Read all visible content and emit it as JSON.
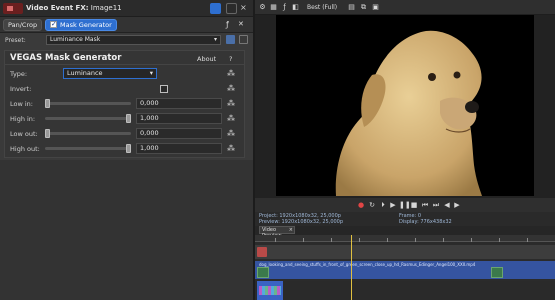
{
  "fx_window": {
    "title_prefix": "Video Event FX:",
    "title_event": "Image11"
  },
  "fx_chain": {
    "items": [
      {
        "label": "Pan/Crop",
        "active": false
      },
      {
        "label": "Mask Generator",
        "active": true
      }
    ]
  },
  "preset": {
    "label": "Preset:",
    "value": "Luminance Mask"
  },
  "plugin": {
    "title": "VEGAS Mask Generator",
    "about_label": "About",
    "help_label": "?",
    "type_label": "Type:",
    "type_value": "Luminance",
    "invert_label": "Invert:",
    "invert_checked": false,
    "params": [
      {
        "label": "Low in:",
        "value": "0,000",
        "fraction": 0.0
      },
      {
        "label": "High in:",
        "value": "1,000",
        "fraction": 1.0
      },
      {
        "label": "Low out:",
        "value": "0,000",
        "fraction": 0.0
      },
      {
        "label": "High out:",
        "value": "1,000",
        "fraction": 1.0
      }
    ]
  },
  "preview": {
    "quality": "Best (Full)",
    "project_line": "Project:  1920x1080x32, 25,000p",
    "preview_line": "Preview:  1920x1080x32, 25,000p",
    "frame_line": "Frame:   0",
    "display_line": "Display:  776x438x32",
    "tab_label": "Video Preview"
  },
  "timeline": {
    "clip_name": "dog_looking_and_seeing_stuffs_in_front_of_green_screen_close_up_hd_Rasmus_Edinger_Angel100_XXII.mp4"
  },
  "colors": {
    "accent": "#2e6fd0",
    "fx_chip": "#6b1f1f",
    "track_blue": "#3554a0"
  },
  "icons": [
    "fx-chip-icon",
    "keyframe-icon",
    "save-preset-icon",
    "delete-preset-icon",
    "play-icon",
    "stop-icon",
    "record-icon"
  ]
}
